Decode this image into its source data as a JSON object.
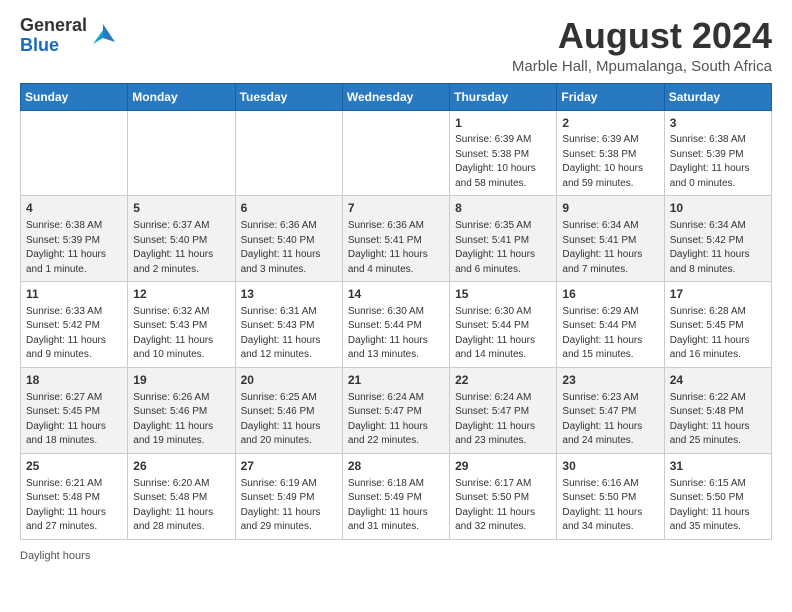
{
  "logo": {
    "general": "General",
    "blue": "Blue"
  },
  "title": "August 2024",
  "subtitle": "Marble Hall, Mpumalanga, South Africa",
  "days_of_week": [
    "Sunday",
    "Monday",
    "Tuesday",
    "Wednesday",
    "Thursday",
    "Friday",
    "Saturday"
  ],
  "weeks": [
    [
      {
        "day": "",
        "info": ""
      },
      {
        "day": "",
        "info": ""
      },
      {
        "day": "",
        "info": ""
      },
      {
        "day": "",
        "info": ""
      },
      {
        "day": "1",
        "info": "Sunrise: 6:39 AM\nSunset: 5:38 PM\nDaylight: 10 hours and 58 minutes."
      },
      {
        "day": "2",
        "info": "Sunrise: 6:39 AM\nSunset: 5:38 PM\nDaylight: 10 hours and 59 minutes."
      },
      {
        "day": "3",
        "info": "Sunrise: 6:38 AM\nSunset: 5:39 PM\nDaylight: 11 hours and 0 minutes."
      }
    ],
    [
      {
        "day": "4",
        "info": "Sunrise: 6:38 AM\nSunset: 5:39 PM\nDaylight: 11 hours and 1 minute."
      },
      {
        "day": "5",
        "info": "Sunrise: 6:37 AM\nSunset: 5:40 PM\nDaylight: 11 hours and 2 minutes."
      },
      {
        "day": "6",
        "info": "Sunrise: 6:36 AM\nSunset: 5:40 PM\nDaylight: 11 hours and 3 minutes."
      },
      {
        "day": "7",
        "info": "Sunrise: 6:36 AM\nSunset: 5:41 PM\nDaylight: 11 hours and 4 minutes."
      },
      {
        "day": "8",
        "info": "Sunrise: 6:35 AM\nSunset: 5:41 PM\nDaylight: 11 hours and 6 minutes."
      },
      {
        "day": "9",
        "info": "Sunrise: 6:34 AM\nSunset: 5:41 PM\nDaylight: 11 hours and 7 minutes."
      },
      {
        "day": "10",
        "info": "Sunrise: 6:34 AM\nSunset: 5:42 PM\nDaylight: 11 hours and 8 minutes."
      }
    ],
    [
      {
        "day": "11",
        "info": "Sunrise: 6:33 AM\nSunset: 5:42 PM\nDaylight: 11 hours and 9 minutes."
      },
      {
        "day": "12",
        "info": "Sunrise: 6:32 AM\nSunset: 5:43 PM\nDaylight: 11 hours and 10 minutes."
      },
      {
        "day": "13",
        "info": "Sunrise: 6:31 AM\nSunset: 5:43 PM\nDaylight: 11 hours and 12 minutes."
      },
      {
        "day": "14",
        "info": "Sunrise: 6:30 AM\nSunset: 5:44 PM\nDaylight: 11 hours and 13 minutes."
      },
      {
        "day": "15",
        "info": "Sunrise: 6:30 AM\nSunset: 5:44 PM\nDaylight: 11 hours and 14 minutes."
      },
      {
        "day": "16",
        "info": "Sunrise: 6:29 AM\nSunset: 5:44 PM\nDaylight: 11 hours and 15 minutes."
      },
      {
        "day": "17",
        "info": "Sunrise: 6:28 AM\nSunset: 5:45 PM\nDaylight: 11 hours and 16 minutes."
      }
    ],
    [
      {
        "day": "18",
        "info": "Sunrise: 6:27 AM\nSunset: 5:45 PM\nDaylight: 11 hours and 18 minutes."
      },
      {
        "day": "19",
        "info": "Sunrise: 6:26 AM\nSunset: 5:46 PM\nDaylight: 11 hours and 19 minutes."
      },
      {
        "day": "20",
        "info": "Sunrise: 6:25 AM\nSunset: 5:46 PM\nDaylight: 11 hours and 20 minutes."
      },
      {
        "day": "21",
        "info": "Sunrise: 6:24 AM\nSunset: 5:47 PM\nDaylight: 11 hours and 22 minutes."
      },
      {
        "day": "22",
        "info": "Sunrise: 6:24 AM\nSunset: 5:47 PM\nDaylight: 11 hours and 23 minutes."
      },
      {
        "day": "23",
        "info": "Sunrise: 6:23 AM\nSunset: 5:47 PM\nDaylight: 11 hours and 24 minutes."
      },
      {
        "day": "24",
        "info": "Sunrise: 6:22 AM\nSunset: 5:48 PM\nDaylight: 11 hours and 25 minutes."
      }
    ],
    [
      {
        "day": "25",
        "info": "Sunrise: 6:21 AM\nSunset: 5:48 PM\nDaylight: 11 hours and 27 minutes."
      },
      {
        "day": "26",
        "info": "Sunrise: 6:20 AM\nSunset: 5:48 PM\nDaylight: 11 hours and 28 minutes."
      },
      {
        "day": "27",
        "info": "Sunrise: 6:19 AM\nSunset: 5:49 PM\nDaylight: 11 hours and 29 minutes."
      },
      {
        "day": "28",
        "info": "Sunrise: 6:18 AM\nSunset: 5:49 PM\nDaylight: 11 hours and 31 minutes."
      },
      {
        "day": "29",
        "info": "Sunrise: 6:17 AM\nSunset: 5:50 PM\nDaylight: 11 hours and 32 minutes."
      },
      {
        "day": "30",
        "info": "Sunrise: 6:16 AM\nSunset: 5:50 PM\nDaylight: 11 hours and 34 minutes."
      },
      {
        "day": "31",
        "info": "Sunrise: 6:15 AM\nSunset: 5:50 PM\nDaylight: 11 hours and 35 minutes."
      }
    ]
  ],
  "footer": "Daylight hours"
}
